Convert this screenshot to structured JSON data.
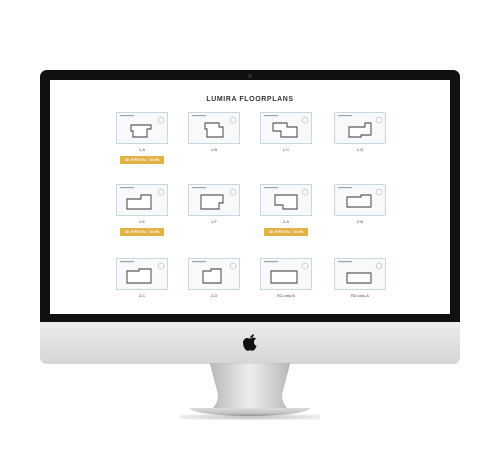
{
  "page": {
    "title": "LUMIRA FLOORPLANS"
  },
  "floorplans": [
    {
      "name": "1-A",
      "tour": "3D VIRTUAL TOUR"
    },
    {
      "name": "1-B"
    },
    {
      "name": "1-C"
    },
    {
      "name": "1-D"
    },
    {
      "name": "1-E",
      "tour": "3D VIRTUAL TOUR"
    },
    {
      "name": "1-F"
    },
    {
      "name": "2-A",
      "tour": "3D VIRTUAL TOUR"
    },
    {
      "name": "2-B"
    },
    {
      "name": "2-C"
    },
    {
      "name": "2-D"
    },
    {
      "name": "R2-only-B"
    },
    {
      "name": "R2-only-A"
    }
  ],
  "colors": {
    "accent": "#e3b045",
    "thumb_border": "#c9d7de",
    "bezel": "#101010",
    "aluminum": "#dcdcdc"
  },
  "icons": {
    "apple": "apple-logo-icon"
  }
}
